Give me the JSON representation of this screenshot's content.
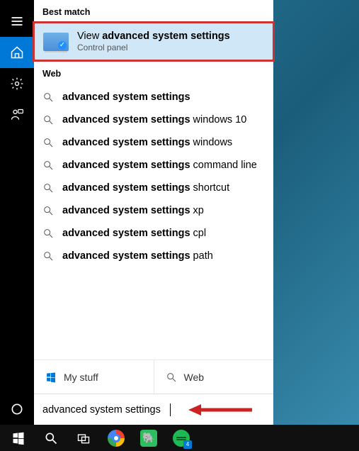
{
  "section_best": "Best match",
  "best_match": {
    "prefix": "View ",
    "bold": "advanced system settings",
    "sub": "Control panel"
  },
  "section_web": "Web",
  "web_items": [
    {
      "bold": "advanced system settings",
      "suffix": ""
    },
    {
      "bold": "advanced system settings",
      "suffix": " windows 10"
    },
    {
      "bold": "advanced system settings",
      "suffix": " windows"
    },
    {
      "bold": "advanced system settings",
      "suffix": " command line"
    },
    {
      "bold": "advanced system settings",
      "suffix": " shortcut"
    },
    {
      "bold": "advanced system settings",
      "suffix": " xp"
    },
    {
      "bold": "advanced system settings",
      "suffix": " cpl"
    },
    {
      "bold": "advanced system settings",
      "suffix": " path"
    }
  ],
  "tabs": {
    "mystuff": "My stuff",
    "web": "Web"
  },
  "search_value": "advanced system settings",
  "spotify_badge": "4"
}
